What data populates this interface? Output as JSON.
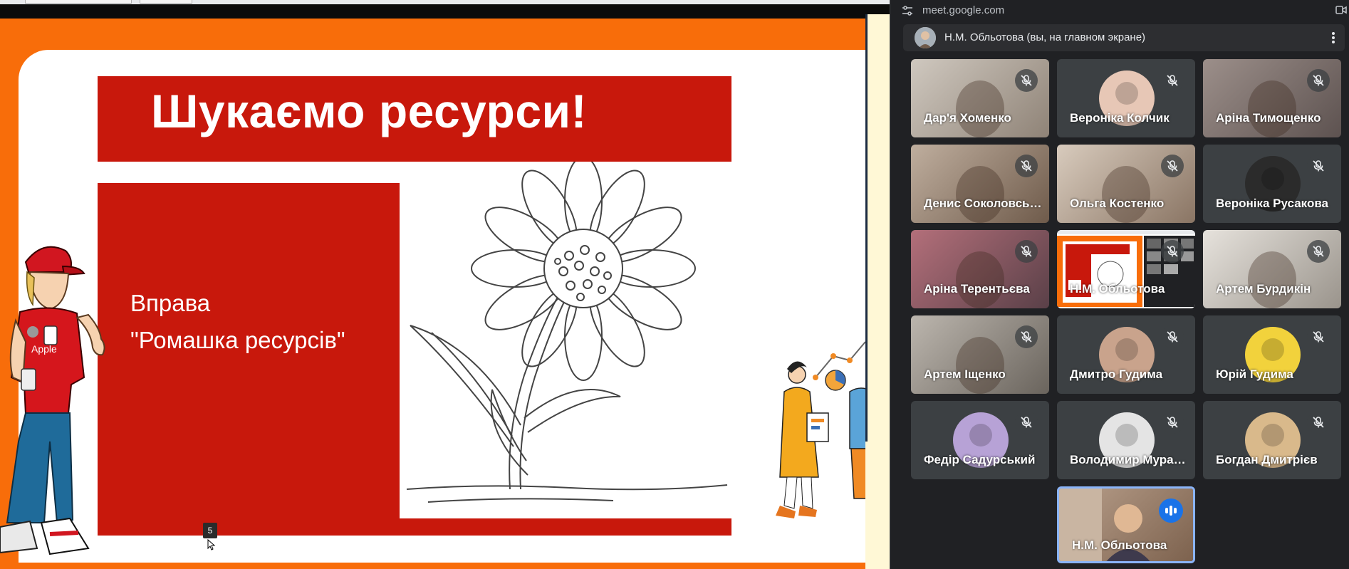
{
  "browser": {
    "url": "meet.google.com"
  },
  "slide": {
    "title": "Шукаємо ресурси!",
    "exercise_label": "Вправа",
    "exercise_name": "\"Ромашка ресурсів\"",
    "mascot_cap_text": "",
    "mascot_shirt_text": "Apple",
    "slide_number": "5"
  },
  "meet": {
    "self_label": "Н.М. Обльотова (вы, на главном экране)",
    "participants": [
      {
        "name": "Дар'я Хоменко",
        "muted": true,
        "kind": "video"
      },
      {
        "name": "Вероніка Колчик",
        "muted": true,
        "kind": "avatar"
      },
      {
        "name": "Аріна Тимощенко",
        "muted": true,
        "kind": "video"
      },
      {
        "name": "Денис Соколовський",
        "muted": true,
        "kind": "video"
      },
      {
        "name": "Ольга Костенко",
        "muted": true,
        "kind": "video"
      },
      {
        "name": "Вероніка Русакова",
        "muted": true,
        "kind": "avatar"
      },
      {
        "name": "Аріна Терентьєва",
        "muted": true,
        "kind": "video"
      },
      {
        "name": "Н.М. Обльотова",
        "muted": false,
        "kind": "screen"
      },
      {
        "name": "Артем Бурдикін",
        "muted": true,
        "kind": "video"
      },
      {
        "name": "Артем Іщенко",
        "muted": true,
        "kind": "video"
      },
      {
        "name": "Дмитро Гудима",
        "muted": true,
        "kind": "avatar"
      },
      {
        "name": "Юрій Гудима",
        "muted": true,
        "kind": "avatar"
      },
      {
        "name": "Федір Садурський",
        "muted": true,
        "kind": "avatar"
      },
      {
        "name": "Володимир Муравйов",
        "muted": true,
        "kind": "avatar"
      },
      {
        "name": "Богдан Дмитрієв",
        "muted": true,
        "kind": "avatar"
      }
    ],
    "speaker": {
      "name": "Н.М. Обльотова",
      "speaking": true
    }
  },
  "colors": {
    "slide_orange": "#f86d0a",
    "slide_red": "#c8180c",
    "meet_bg": "#202124",
    "tile_bg": "#3c4043",
    "speaking_blue": "#1a73e8"
  }
}
